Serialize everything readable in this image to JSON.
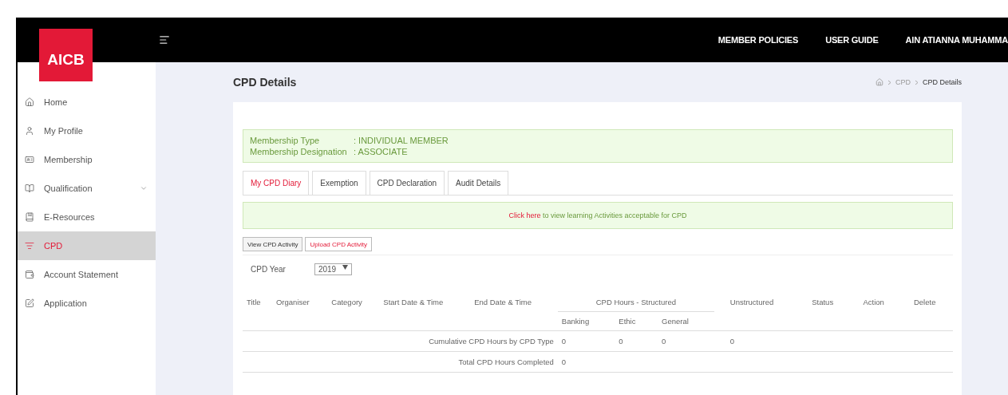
{
  "logo": {
    "text": "AICB"
  },
  "topbar": {
    "links": [
      "MEMBER POLICIES",
      "USER GUIDE",
      "AIN ATIANNA MUHAMMA"
    ]
  },
  "sidebar": {
    "items": [
      {
        "label": "Home",
        "selected": false
      },
      {
        "label": "My Profile",
        "selected": false
      },
      {
        "label": "Membership",
        "selected": false
      },
      {
        "label": "Qualification",
        "selected": false,
        "expanded": false
      },
      {
        "label": "E-Resources",
        "selected": false
      },
      {
        "label": "CPD",
        "selected": true
      },
      {
        "label": "Account Statement",
        "selected": false
      },
      {
        "label": "Application",
        "selected": false
      }
    ]
  },
  "page": {
    "title": "CPD Details",
    "breadcrumb": [
      "CPD",
      "CPD Details"
    ]
  },
  "membership": [
    {
      "label": "Membership Type",
      "value": ": INDIVIDUAL MEMBER"
    },
    {
      "label": "Membership Designation",
      "value": ": ASSOCIATE"
    }
  ],
  "tabs": [
    {
      "label": "My CPD Diary",
      "selected": true
    },
    {
      "label": "Exemption",
      "selected": false
    },
    {
      "label": "CPD Declaration",
      "selected": false
    },
    {
      "label": "Audit Details",
      "selected": false
    }
  ],
  "notice": {
    "link": "Click here",
    "text": " to view learning Activities acceptable for CPD"
  },
  "buttons": [
    {
      "label": "View CPD Activity",
      "selected": false
    },
    {
      "label": "Upload CPD Activity",
      "selected": true
    }
  ],
  "year": {
    "label": "CPD Year",
    "value": "2019"
  },
  "table": {
    "columns": [
      "Title",
      "Organiser",
      "Category",
      "Start Date & Time",
      "End Date & Time"
    ],
    "group": {
      "label": "CPD Hours - Structured",
      "columns": [
        "Banking",
        "Ethic",
        "General"
      ]
    },
    "columns_after": [
      "Unstructured",
      "Status",
      "Action",
      "Delete"
    ],
    "summary": [
      {
        "label": "Cumulative CPD Hours by CPD Type",
        "values": [
          "0",
          "0",
          "0",
          "0"
        ]
      },
      {
        "label": "Total CPD Hours Completed",
        "values": [
          "0"
        ]
      }
    ]
  }
}
